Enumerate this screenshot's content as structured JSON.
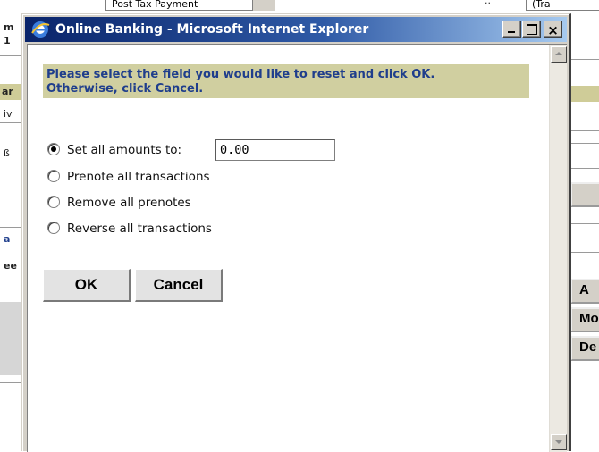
{
  "background": {
    "field_left": "Post Tax Payment",
    "field_right": "(Tra",
    "row_glyphs": [
      "m",
      "1",
      "ar",
      "iv",
      "ß",
      "a",
      "ee"
    ],
    "side_buttons": [
      "A",
      "Mo",
      "De"
    ]
  },
  "window": {
    "title": "Online Banking - Microsoft Internet Explorer",
    "title_icon": "ie-icon",
    "controls": {
      "close_glyph": "×"
    }
  },
  "dialog": {
    "instructions_line1": "Please select the field you would like to reset and click OK.",
    "instructions_line2": "Otherwise, click Cancel.",
    "options": [
      {
        "label": "Set all amounts to:",
        "checked": true
      },
      {
        "label": "Prenote all transactions",
        "checked": false
      },
      {
        "label": "Remove all prenotes",
        "checked": false
      },
      {
        "label": "Reverse all transactions",
        "checked": false
      }
    ],
    "amount_value": "0.00",
    "ok_label": "OK",
    "cancel_label": "Cancel"
  },
  "colors": {
    "titlebar_start": "#0a246a",
    "titlebar_end": "#a6caf0",
    "instructions_bg": "#d0cfa0",
    "instructions_text": "#1f3e8c"
  }
}
